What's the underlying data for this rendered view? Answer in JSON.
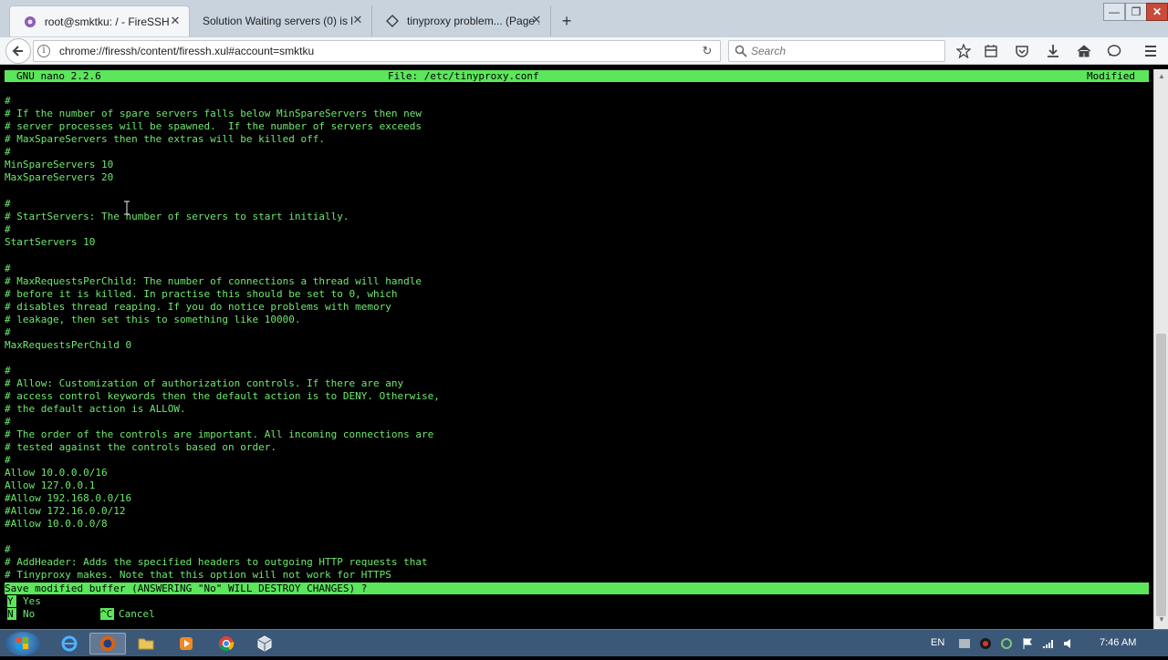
{
  "browser": {
    "tabs": [
      {
        "label": "root@smktku: / - FireSSH",
        "icon": "firessh-icon",
        "active": true
      },
      {
        "label": "Solution Waiting servers (0) is l...",
        "icon": "",
        "active": false
      },
      {
        "label": "tinyproxy problem... (Page ...",
        "icon": "tinyproxy-icon",
        "active": false
      }
    ],
    "new_tab": "+",
    "url": "chrome://firessh/content/firessh.xul#account=smktku",
    "search_placeholder": "Search",
    "window_controls": {
      "minimize": "—",
      "maximize": "❐",
      "close": "✕"
    }
  },
  "terminal": {
    "header": {
      "app": "GNU nano 2.2.6",
      "file": "File: /etc/tinyproxy.conf",
      "status": "Modified"
    },
    "lines": [
      {
        "text": "#"
      },
      {
        "text": "# If the number of spare servers falls below MinSpareServers then new"
      },
      {
        "text": "# server processes will be spawned.  If the number of servers exceeds"
      },
      {
        "text": "# MaxSpareServers then the extras will be killed off."
      },
      {
        "text": "#"
      },
      {
        "text": "MinSpareServers 10"
      },
      {
        "text": "MaxSpareServers 20"
      },
      {
        "text": ""
      },
      {
        "text": "#"
      },
      {
        "text": "# StartServers: The number of servers to start initially."
      },
      {
        "text": "#"
      },
      {
        "text": "StartServers 10"
      },
      {
        "text": ""
      },
      {
        "text": "#"
      },
      {
        "text": "# MaxRequestsPerChild: The number of connections a thread will handle"
      },
      {
        "text": "# before it is killed. In practise this should be set to 0, which"
      },
      {
        "text": "# disables thread reaping. If you do notice problems with memory"
      },
      {
        "text": "# leakage, then set this to something like 10000."
      },
      {
        "text": "#"
      },
      {
        "text": "MaxRequestsPerChild 0"
      },
      {
        "text": ""
      },
      {
        "text": "#"
      },
      {
        "text": "# Allow: Customization of authorization controls. If there are any"
      },
      {
        "text": "# access control keywords then the default action is to DENY. Otherwise,"
      },
      {
        "text": "# the default action is ALLOW."
      },
      {
        "text": "#"
      },
      {
        "text": "# The order of the controls are important. All incoming connections are"
      },
      {
        "text": "# tested against the controls based on order."
      },
      {
        "text": "#"
      },
      {
        "text": "Allow 10.0.0.0/16"
      },
      {
        "text": "Allow 127.0.0.1"
      },
      {
        "text": "#Allow 192.168.0.0/16"
      },
      {
        "text": "#Allow 172.16.0.0/12"
      },
      {
        "text": "#Allow 10.0.0.0/8"
      },
      {
        "text": ""
      },
      {
        "text": "#"
      },
      {
        "text": "# AddHeader: Adds the specified headers to outgoing HTTP requests that"
      },
      {
        "text": "# Tinyproxy makes. Note that this option will not work for HTTPS"
      }
    ],
    "prompt": "Save modified buffer (ANSWERING \"No\" WILL DESTROY CHANGES) ?",
    "options": {
      "yes_key": "Y",
      "yes_label": "Yes",
      "no_key": "N",
      "no_label": "No",
      "cancel_key": "^C",
      "cancel_label": "Cancel"
    }
  },
  "taskbar": {
    "language": "EN",
    "clock": "7:46 AM"
  },
  "colors": {
    "terminal_fg": "#6ee86e",
    "nano_bar": "#5be65b",
    "taskbar": "#3c5878"
  }
}
